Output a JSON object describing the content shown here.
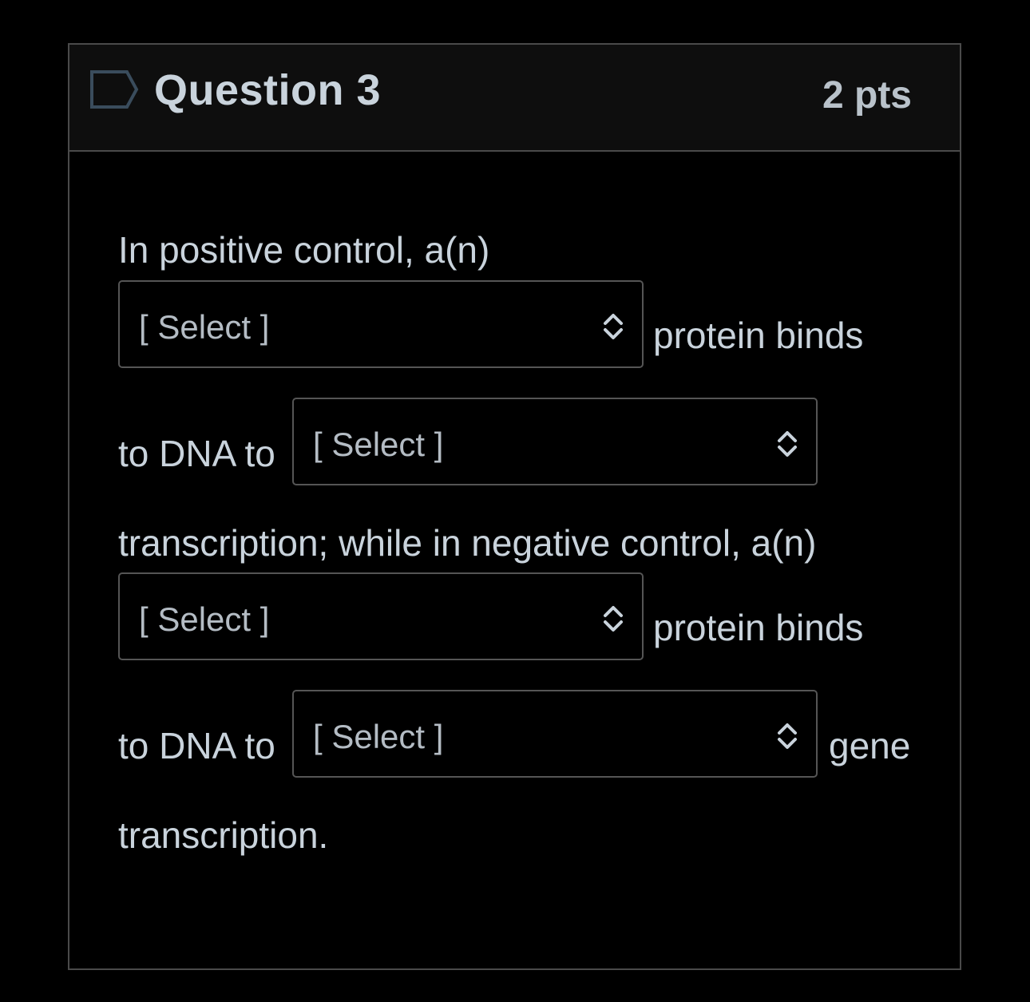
{
  "question": {
    "title": "Question 3",
    "points": "2 pts"
  },
  "body": {
    "line1": "In positive control, a(n)",
    "after_select1": "protein binds",
    "before_select2": "to DNA to",
    "line3": "transcription; while in negative control, a(n)",
    "after_select3": "protein binds",
    "before_select4": "to DNA to",
    "after_select4": "gene",
    "line_last": "transcription."
  },
  "selects": [
    {
      "value": "[ Select ]"
    },
    {
      "value": "[ Select ]"
    },
    {
      "value": "[ Select ]"
    },
    {
      "value": "[ Select ]"
    }
  ],
  "icons": {
    "flag": "flag-icon",
    "select_arrows": "chevron-up-down-icon"
  },
  "colors": {
    "background": "#000000",
    "header_background": "#0e0e0e",
    "text": "#c9d3dc",
    "border": "#4a4a4a",
    "flag_stroke": "#2a3a48"
  }
}
